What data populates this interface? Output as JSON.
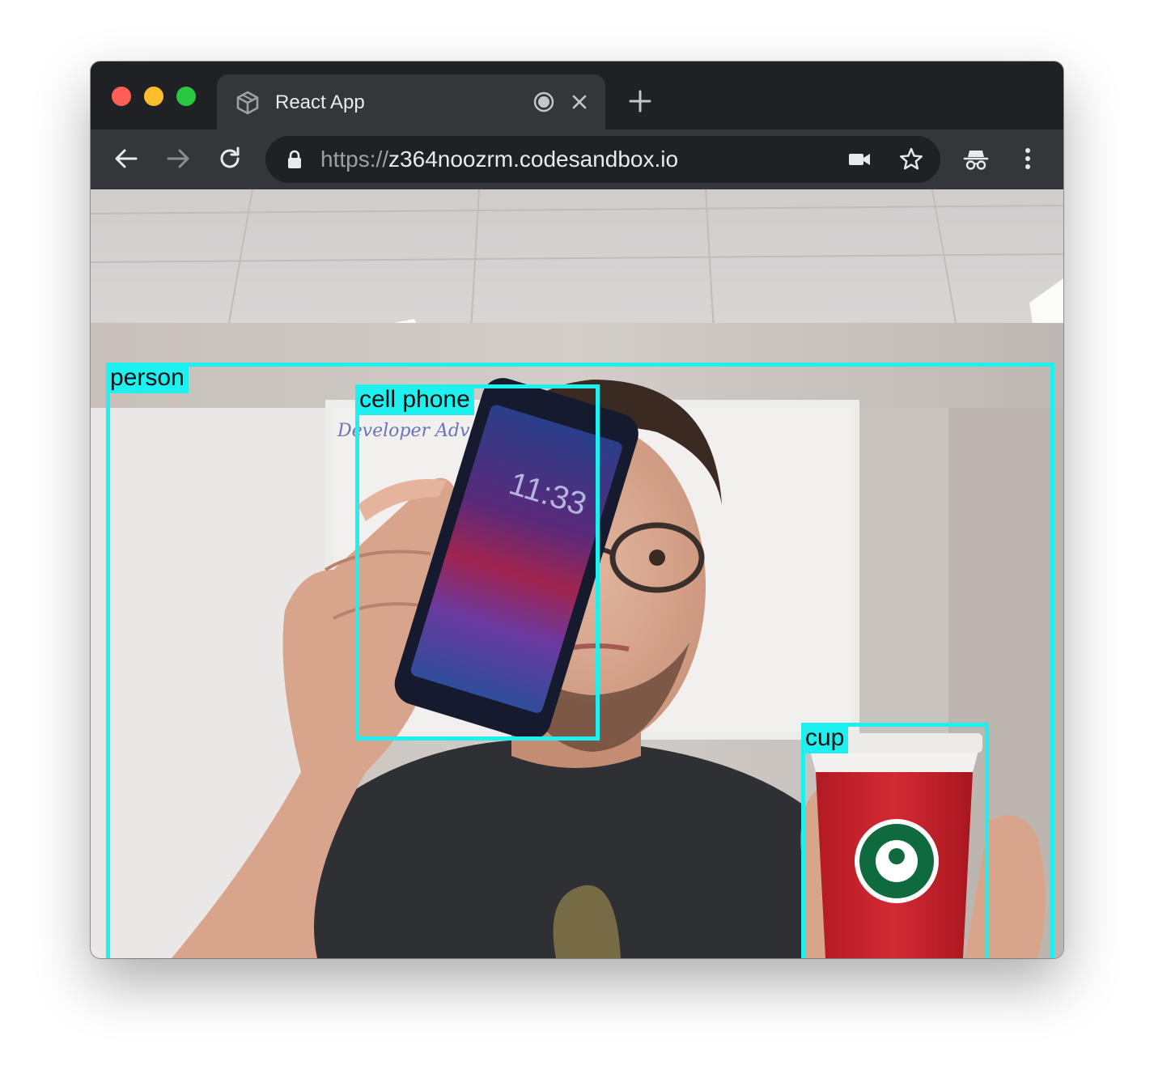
{
  "browser": {
    "tab": {
      "title": "React App",
      "favicon": "codesandbox-cube-icon"
    },
    "url": {
      "scheme": "https://",
      "host": "z364noozrm.codesandbox.io"
    }
  },
  "detections": [
    {
      "label": "person"
    },
    {
      "label": "cell phone"
    },
    {
      "label": "cup"
    }
  ],
  "colors": {
    "box": "#1ef0f0",
    "titlebar": "#202124",
    "toolbar": "#35363a"
  }
}
